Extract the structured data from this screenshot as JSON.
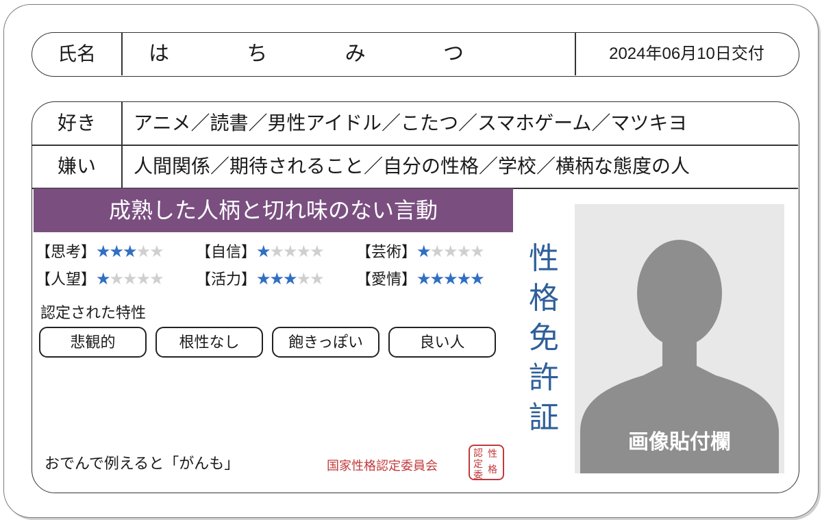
{
  "header": {
    "name_label": "氏名",
    "name_chars": [
      "は",
      "ち",
      "み",
      "つ"
    ],
    "issue_date": "2024年06月10日交付"
  },
  "likes": {
    "label": "好き",
    "value": "アニメ／読書／男性アイドル／こたつ／スマホゲーム／マツキヨ"
  },
  "dislikes": {
    "label": "嫌い",
    "value": "人間関係／期待されること／自分の性格／学校／横柄な態度の人"
  },
  "banner": "成熟した人柄と切れ味のない言動",
  "ratings": [
    {
      "label": "【思考】",
      "stars": 3,
      "max": 5
    },
    {
      "label": "【自信】",
      "stars": 1,
      "max": 5
    },
    {
      "label": "【芸術】",
      "stars": 1,
      "max": 5
    },
    {
      "label": "【人望】",
      "stars": 1,
      "max": 5
    },
    {
      "label": "【活力】",
      "stars": 3,
      "max": 5
    },
    {
      "label": "【愛情】",
      "stars": 5,
      "max": 5
    }
  ],
  "traits_title": "認定された特性",
  "traits": [
    "悲観的",
    "根性なし",
    "飽きっぽい",
    "良い人"
  ],
  "oden": "おでんで例えると「がんも」",
  "issuer": "国家性格認定委員会",
  "seal_chars": [
    "性",
    "格",
    "認",
    "定",
    "委"
  ],
  "vertical_title": [
    "性",
    "格",
    "免",
    "許",
    "証"
  ],
  "photo_label": "画像貼付欄",
  "colors": {
    "banner": "#7a4f80",
    "star": "#2f6fc4",
    "title": "#2f5f9a",
    "issuer": "#c0393b"
  }
}
